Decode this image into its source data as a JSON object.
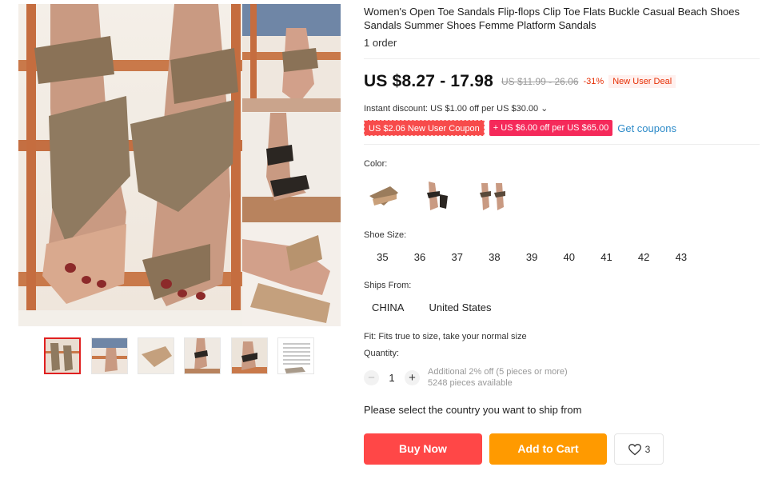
{
  "product": {
    "title": "Women's Open Toe Sandals Flip-flops Clip Toe Flats Buckle Casual Beach Shoes Sandals Summer Shoes Femme Platform Sandals",
    "orders": "1 order"
  },
  "price": {
    "current": "US $8.27 - 17.98",
    "original": "US $11.99 - 26.06",
    "discount": "-31%",
    "badge": "New User Deal"
  },
  "promotions": {
    "instant_discount": "Instant discount: US $1.00 off per US $30.00 ⌄",
    "coupon_new_user": "US $2.06 New User Coupon",
    "coupon_store": "+ US $6.00 off per US $65.00",
    "get_coupons": "Get coupons"
  },
  "color": {
    "label": "Color:",
    "options": [
      "brown-icon",
      "black-icon",
      "beige-icon"
    ]
  },
  "size": {
    "label": "Shoe Size:",
    "options": [
      "35",
      "36",
      "37",
      "38",
      "39",
      "40",
      "41",
      "42",
      "43"
    ]
  },
  "ships_from": {
    "label": "Ships From:",
    "options": [
      "CHINA",
      "United States"
    ]
  },
  "fit": "Fit: Fits true to size, take your normal size",
  "quantity": {
    "label": "Quantity:",
    "value": "1",
    "minus": "−",
    "plus": "+",
    "additional": "Additional 2% off (5 pieces or more)",
    "available": "5248 pieces available"
  },
  "ship_message": "Please select the country you want to ship from",
  "actions": {
    "buy_now": "Buy Now",
    "add_to_cart": "Add to Cart",
    "wishlist_count": "3"
  },
  "colors": {
    "buy": "#ff4747",
    "cart": "#ff9a00",
    "accent_red": "#e62e04",
    "link": "#2e8bc9"
  }
}
